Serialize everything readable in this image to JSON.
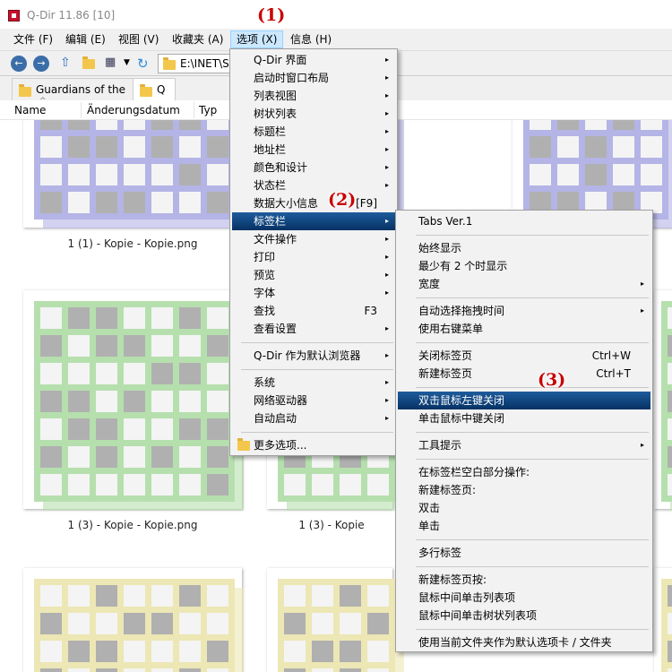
{
  "window": {
    "title": "Q-Dir 11.86 [10]"
  },
  "menubar": {
    "items": [
      "文件 (F)",
      "编辑 (E)",
      "视图 (V)",
      "收藏夹 (A)",
      "选项 (X)",
      "信息 (H)"
    ]
  },
  "toolbar": {
    "address": "E:\\INET\\So"
  },
  "tabs": [
    "Guardians of the",
    "Q"
  ],
  "columns": [
    "Name",
    "Änderungsdatum",
    "Typ"
  ],
  "files": {
    "row2_left": "1 (1) - Kopie - Kopie.png",
    "row3_left": "1 (3) - Kopie - Kopie.png",
    "row3_mid": "1 (3) - Kopie"
  },
  "colors": {
    "blue_tile": "#b4b4e6",
    "green_tile": "#b6dfae",
    "yellow_tile": "#ece7b4",
    "grey_cell": "#b0b0b0",
    "highlight": "#0a3e78"
  },
  "annotations": [
    "(1)",
    "(2)",
    "(3)"
  ],
  "options_menu": {
    "items": [
      {
        "label": "Q-Dir 界面",
        "arrow": "▸"
      },
      {
        "label": "启动时窗口布局",
        "arrow": "▸"
      },
      {
        "label": "列表视图",
        "arrow": "▸"
      },
      {
        "label": "树状列表",
        "arrow": "▸"
      },
      {
        "label": "标题栏",
        "arrow": "▸"
      },
      {
        "label": "地址栏",
        "arrow": "▸"
      },
      {
        "label": "颜色和设计",
        "arrow": "▸"
      },
      {
        "label": "状态栏",
        "arrow": "▸"
      },
      {
        "label": "数据大小信息",
        "shortcut": "[F9]"
      },
      {
        "label": "标签栏",
        "arrow": "▸"
      },
      {
        "label": "文件操作",
        "arrow": "▸"
      },
      {
        "label": "打印",
        "arrow": "▸"
      },
      {
        "label": "预览",
        "arrow": "▸"
      },
      {
        "label": "字体",
        "arrow": "▸"
      },
      {
        "label": "查找",
        "shortcut": "F3"
      },
      {
        "label": "查看设置",
        "arrow": "▸"
      },
      {
        "label": "Q-Dir 作为默认浏览器",
        "arrow": "▸"
      },
      {
        "label": "系统",
        "arrow": "▸"
      },
      {
        "label": "网络驱动器",
        "arrow": "▸"
      },
      {
        "label": "自动启动",
        "arrow": "▸"
      },
      {
        "label": "更多选项..."
      }
    ]
  },
  "tabbar_submenu": {
    "items": [
      {
        "label": "Tabs Ver.1"
      },
      {
        "label": "始终显示"
      },
      {
        "label": "最少有 2 个时显示"
      },
      {
        "label": "宽度",
        "arrow": "▸"
      },
      {
        "label": "自动选择拖拽时间",
        "arrow": "▸"
      },
      {
        "label": "使用右键菜单"
      },
      {
        "label": "关闭标签页",
        "shortcut": "Ctrl+W"
      },
      {
        "label": "新建标签页",
        "shortcut": "Ctrl+T"
      },
      {
        "label": "双击鼠标左键关闭"
      },
      {
        "label": "单击鼠标中键关闭"
      },
      {
        "label": "工具提示",
        "arrow": "▸"
      },
      {
        "label": "在标签栏空白部分操作:"
      },
      {
        "label": "新建标签页:"
      },
      {
        "label": "双击"
      },
      {
        "label": "单击"
      },
      {
        "label": "多行标签"
      },
      {
        "label": "新建标签页按:"
      },
      {
        "label": "鼠标中间单击列表项"
      },
      {
        "label": "鼠标中间单击树状列表项"
      },
      {
        "label": "使用当前文件夹作为默认选项卡 / 文件夹"
      }
    ]
  }
}
